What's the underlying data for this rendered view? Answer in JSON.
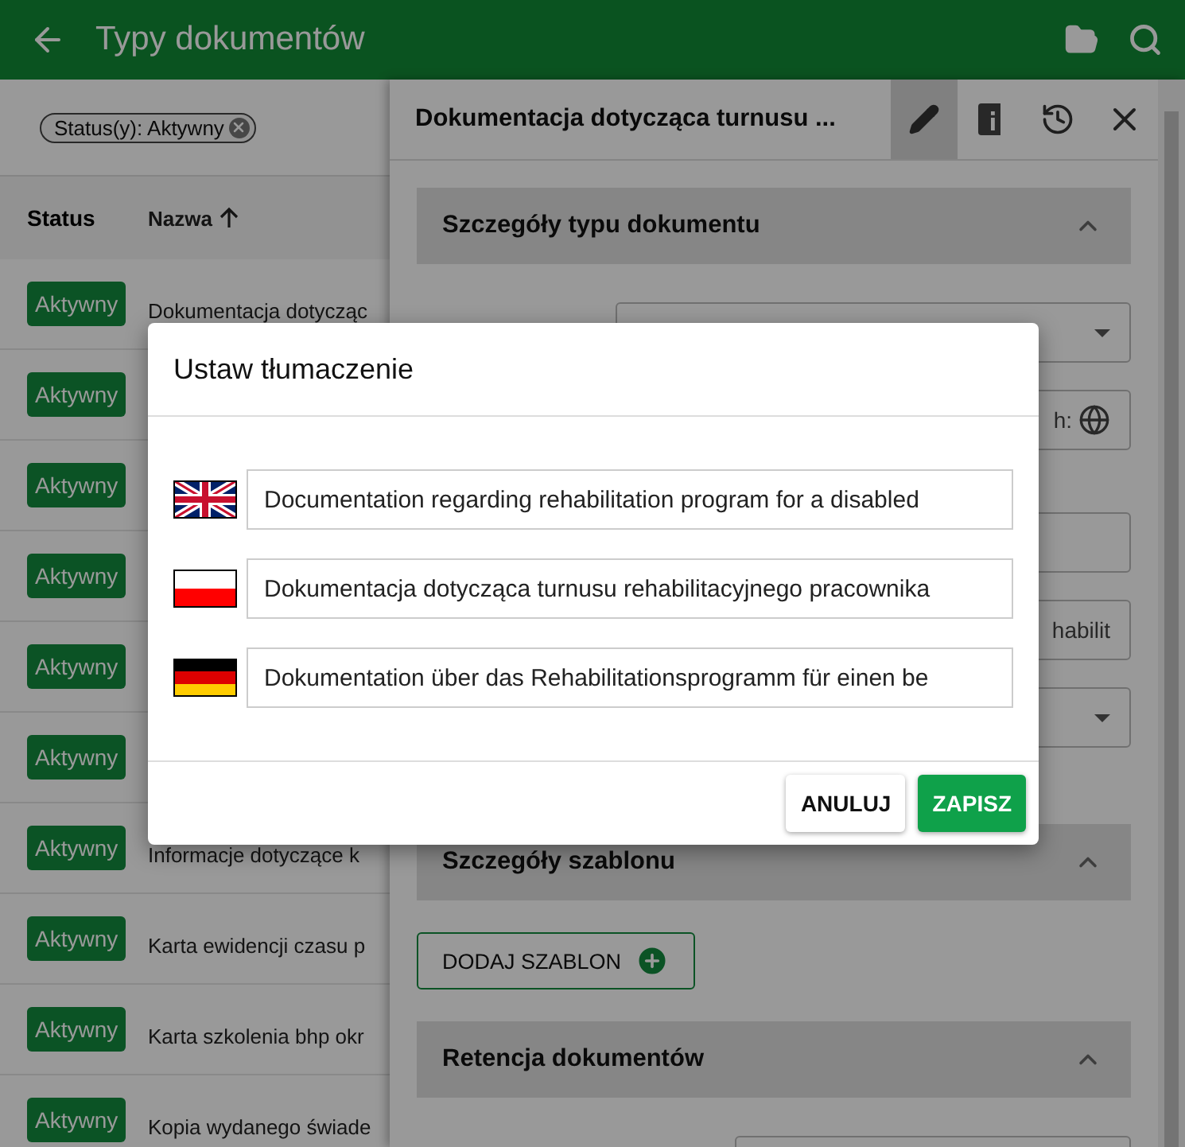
{
  "app_bar": {
    "title": "Typy dokumentów"
  },
  "filter_chip": {
    "label": "Status(y): Aktywny"
  },
  "table": {
    "columns": [
      {
        "label": "Status",
        "kind": "plain"
      },
      {
        "label": "Nazwa",
        "kind": "ascending"
      }
    ],
    "rows": [
      {
        "status": "Aktywny",
        "name": "Dokumentacja dotycząc"
      },
      {
        "status": "Aktywny"
      },
      {
        "status": "Aktywny"
      },
      {
        "status": "Aktywny"
      },
      {
        "status": "Aktywny"
      },
      {
        "status": "Aktywny"
      },
      {
        "status": "Aktywny",
        "name": "Informacje dotyczące k"
      },
      {
        "status": "Aktywny",
        "name": "Karta ewidencji czasu p"
      },
      {
        "status": "Aktywny",
        "name": "Karta szkolenia bhp okr"
      },
      {
        "status": "Aktywny",
        "name": "Kopia wydanego świade"
      }
    ]
  },
  "side_panel": {
    "title": "Dokumentacja dotycząca turnusu ...",
    "toolbar": [
      {
        "kind": "edit",
        "selected": true
      },
      {
        "kind": "info",
        "selected": false
      },
      {
        "kind": "history",
        "selected": false
      },
      {
        "kind": "close",
        "selected": false
      }
    ],
    "sections": [
      {
        "title": "Szczegóły typu dokumentu",
        "expanded": true,
        "fields": [
          {
            "kind": "select"
          },
          {
            "kind": "translatable",
            "value": "h:"
          },
          {
            "kind": "text"
          },
          {
            "kind": "text",
            "value": "habilit"
          },
          {
            "kind": "select"
          }
        ]
      },
      {
        "title": "Szczegóły szablonu",
        "expanded": true,
        "button": "DODAJ SZABLON"
      },
      {
        "title": "Retencja dokumentów",
        "expanded": true,
        "fields": [
          {
            "kind": "short"
          }
        ]
      }
    ]
  },
  "dialog": {
    "title": "Ustaw tłumaczenie",
    "translations": [
      {
        "kind": "gb",
        "value": "Documentation regarding rehabilitation program for a disabled"
      },
      {
        "kind": "pl",
        "value": "Dokumentacja dotycząca turnusu rehabilitacyjnego pracownika"
      },
      {
        "kind": "de",
        "value": "Dokumentation über das Rehabilitationsprogramm für einen be"
      }
    ],
    "buttons": [
      {
        "label": "ANULUJ",
        "kind": "secondary"
      },
      {
        "label": "ZAPISZ",
        "kind": "primary"
      }
    ]
  }
}
